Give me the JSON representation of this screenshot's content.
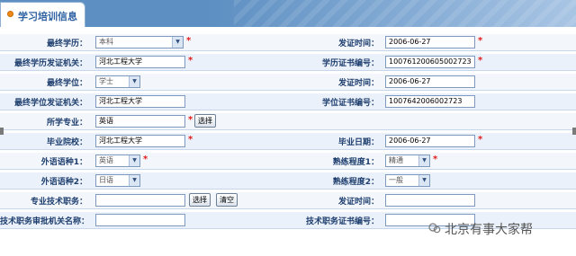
{
  "header": {
    "title": "学习培训信息"
  },
  "rows": [
    {
      "left": {
        "label": "最终学历：",
        "value": "本科",
        "type": "select",
        "required": true
      },
      "right": {
        "label": "发证时间：",
        "value": "2006-06-27",
        "required": true
      }
    },
    {
      "left": {
        "label": "最终学历发证机关：",
        "value": "河北工程大学",
        "required": true
      },
      "right": {
        "label": "学历证书编号：",
        "value": "100761200605002723",
        "required": true
      }
    },
    {
      "left": {
        "label": "最终学位：",
        "value": "学士",
        "type": "select"
      },
      "right": {
        "label": "发证时间：",
        "value": "2006-06-27"
      }
    },
    {
      "left": {
        "label": "最终学位发证机关：",
        "value": "河北工程大学"
      },
      "right": {
        "label": "学位证书编号：",
        "value": "1007642006002723"
      }
    },
    {
      "left": {
        "label": "所学专业：",
        "value": "英语",
        "required": true,
        "button": "选择"
      }
    },
    {
      "left": {
        "label": "毕业院校：",
        "value": "河北工程大学",
        "required": true
      },
      "right": {
        "label": "毕业日期：",
        "value": "2006-06-27",
        "required": true
      }
    },
    {
      "left": {
        "label": "外语语种1：",
        "value": "英语",
        "type": "select",
        "required": true
      },
      "right": {
        "label": "熟练程度1：",
        "value": "精通",
        "type": "select",
        "required": true
      }
    },
    {
      "left": {
        "label": "外语语种2：",
        "value": "日语",
        "type": "select"
      },
      "right": {
        "label": "熟练程度2：",
        "value": "一般",
        "type": "select"
      }
    },
    {
      "left": {
        "label": "专业技术职务：",
        "value": "",
        "button": "选择",
        "button2": "清空"
      },
      "right": {
        "label": "发证时间：",
        "value": ""
      }
    },
    {
      "left": {
        "label": "技术职务审批机关名称：",
        "value": ""
      },
      "right": {
        "label": "技术职务证书编号：",
        "value": ""
      }
    }
  ],
  "watermark": {
    "text": "北京有事大家帮",
    "icon": "wechat-icon"
  },
  "colors": {
    "header": "#5d8fc2",
    "title": "#2f62a3",
    "label": "#1e3e6e",
    "required": "#e21c1c",
    "bullet": "#f08a17"
  }
}
